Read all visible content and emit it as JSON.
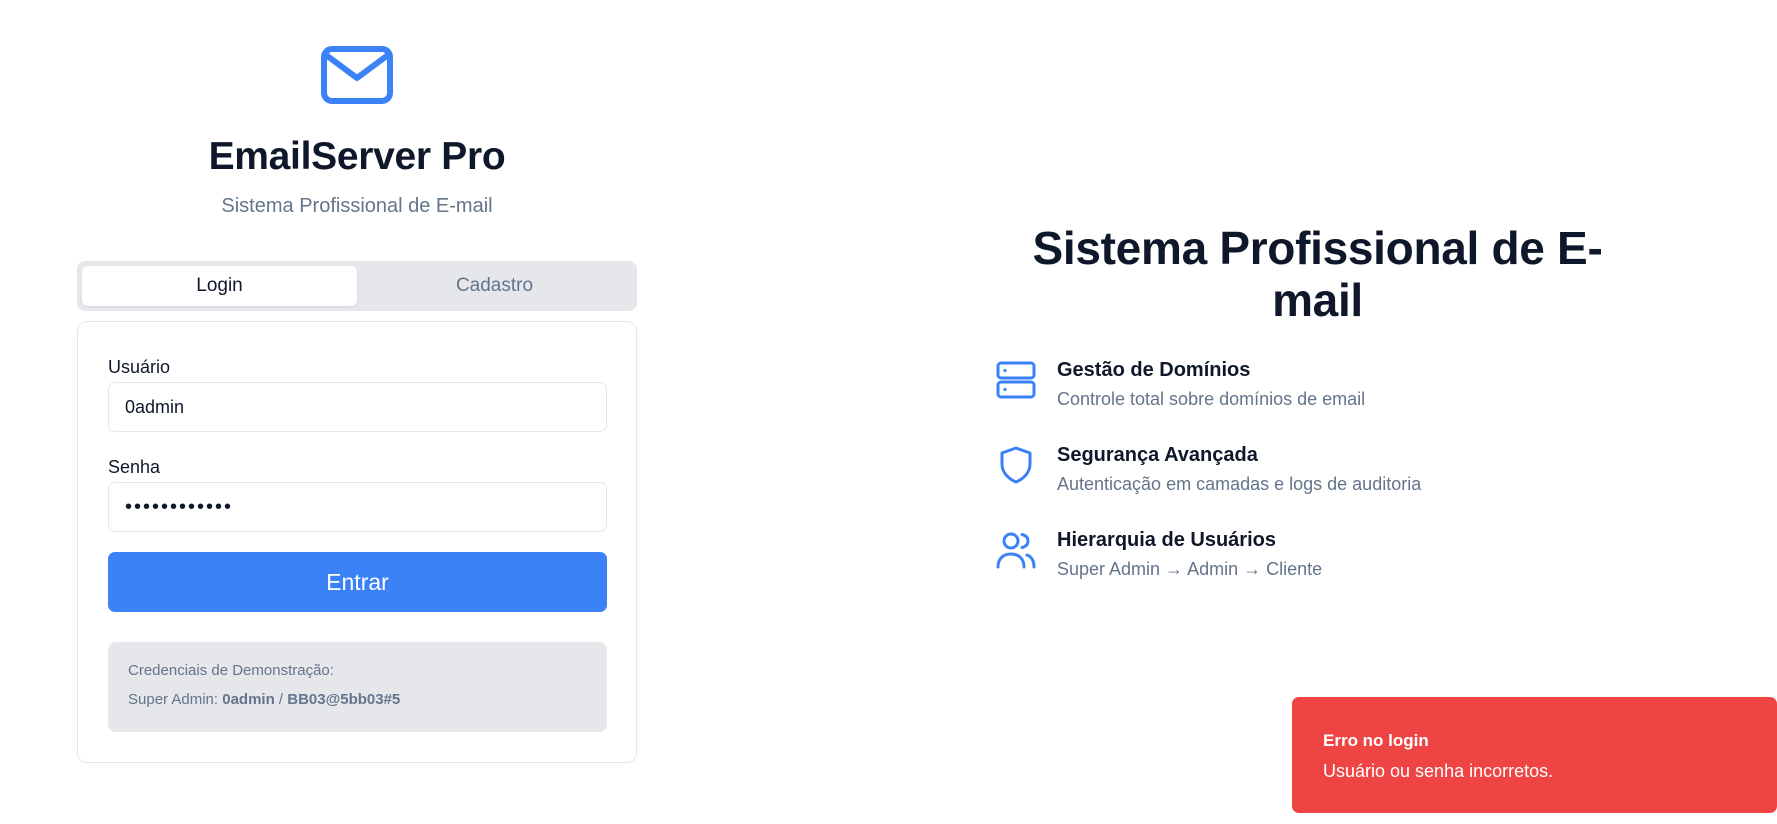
{
  "brand": {
    "title": "EmailServer Pro",
    "subtitle": "Sistema Profissional de E-mail",
    "logo_icon": "mail-icon",
    "accent_color": "#3b82f6"
  },
  "tabs": [
    {
      "label": "Login",
      "active": true
    },
    {
      "label": "Cadastro",
      "active": false
    }
  ],
  "form": {
    "username_label": "Usuário",
    "username_value": "0admin",
    "password_label": "Senha",
    "password_value": "••••••••••••",
    "submit_label": "Entrar",
    "demo": {
      "heading": "Credenciais de Demonstração:",
      "role": "Super Admin:",
      "user": "0admin",
      "separator": "/",
      "password": "BB03@5bb03#5"
    }
  },
  "hero": {
    "title": "Sistema Profissional de E-mail",
    "features": [
      {
        "icon": "server-icon",
        "title": "Gestão de Domínios",
        "description": "Controle total sobre domínios de email"
      },
      {
        "icon": "shield-icon",
        "title": "Segurança Avançada",
        "description": "Autenticação em camadas e logs de auditoria"
      },
      {
        "icon": "users-icon",
        "title": "Hierarquia de Usuários",
        "description": "Super Admin → Admin → Cliente"
      }
    ]
  },
  "toast": {
    "title": "Erro no login",
    "message": "Usuário ou senha incorretos.",
    "color": "#ef4444"
  }
}
